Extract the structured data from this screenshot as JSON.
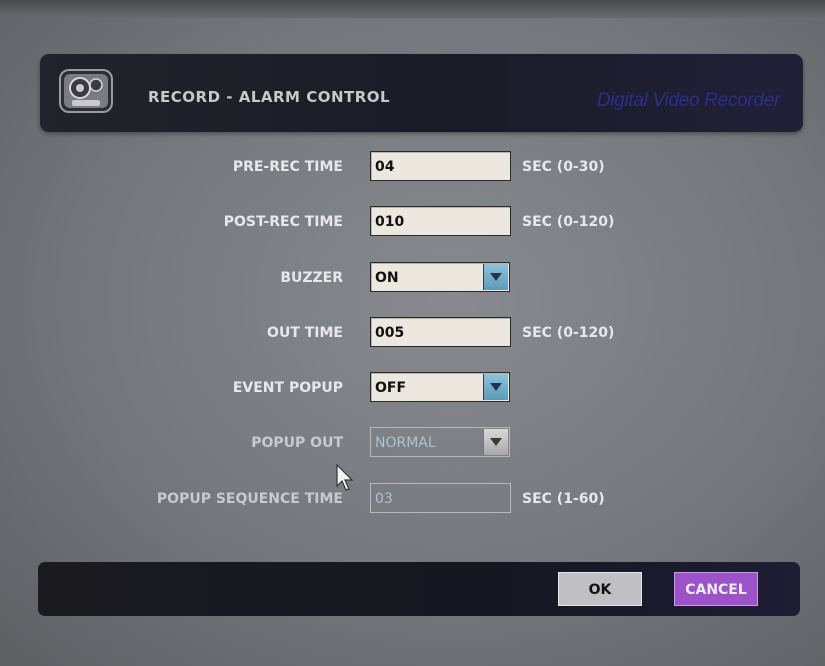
{
  "header": {
    "title": "RECORD - ALARM CONTROL",
    "brand": "Digital Video Recorder",
    "icon": "camera-icon"
  },
  "form": {
    "pre_rec_time": {
      "label": "PRE-REC TIME",
      "value": "04",
      "unit": "SEC (0-30)"
    },
    "post_rec_time": {
      "label": "POST-REC TIME",
      "value": "010",
      "unit": "SEC (0-120)"
    },
    "buzzer": {
      "label": "BUZZER",
      "value": "ON"
    },
    "out_time": {
      "label": "OUT TIME",
      "value": "005",
      "unit": "SEC (0-120)"
    },
    "event_popup": {
      "label": "EVENT POPUP",
      "value": "OFF"
    },
    "popup_out": {
      "label": "POPUP OUT",
      "value": "NORMAL",
      "disabled": true
    },
    "popup_sequence_time": {
      "label": "POPUP SEQUENCE TIME",
      "value": "03",
      "unit": "SEC (1-60)",
      "disabled": true
    }
  },
  "footer": {
    "ok_label": "OK",
    "cancel_label": "CANCEL"
  },
  "colors": {
    "background": "#75777c",
    "bar": "#1b1b27",
    "brand": "#2a2f8a",
    "cancel": "#9c52c9",
    "dropdown": "#6fa9c5"
  }
}
